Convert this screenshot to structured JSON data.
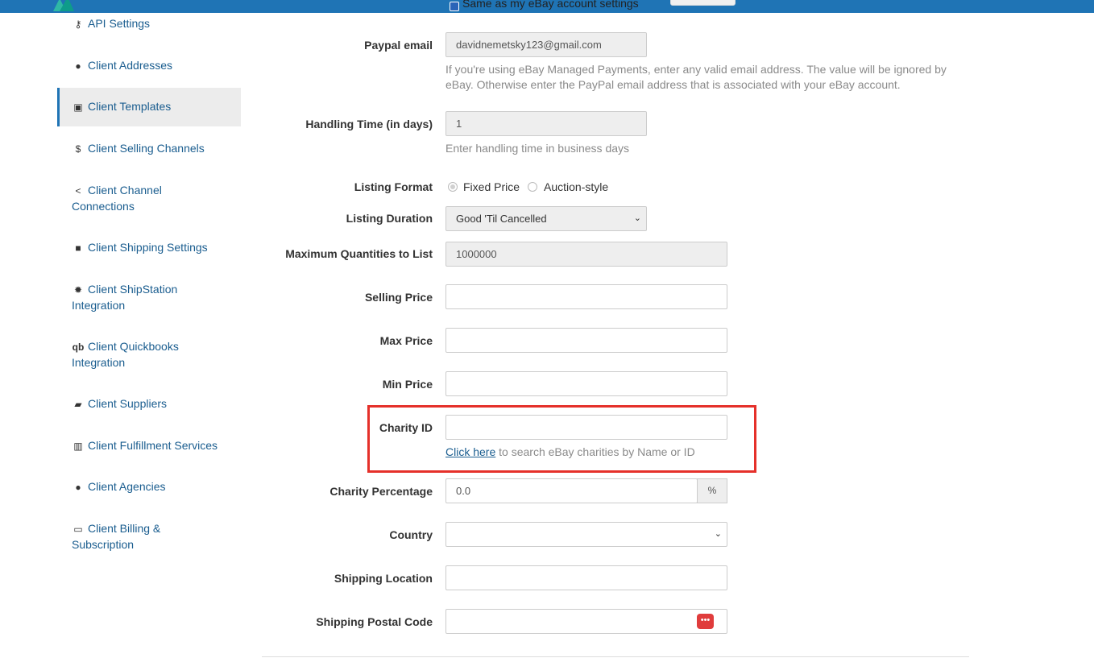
{
  "header": {
    "same_as_checkbox_label": "Same as my eBay account settings"
  },
  "sidebar": {
    "items": [
      {
        "label": "API Settings",
        "icon": "key-icon"
      },
      {
        "label": "Client Addresses",
        "icon": "map-marker-icon"
      },
      {
        "label": "Client Templates",
        "icon": "image-icon",
        "active": true
      },
      {
        "label": "Client Selling Channels",
        "icon": "dollar-icon"
      },
      {
        "label": "Client Channel Connections",
        "icon": "share-icon"
      },
      {
        "label": "Client Shipping Settings",
        "icon": "box-icon"
      },
      {
        "label": "Client ShipStation Integration",
        "icon": "gear-icon"
      },
      {
        "label": "Client Quickbooks Integration",
        "icon": "quickbooks-icon"
      },
      {
        "label": "Client Suppliers",
        "icon": "truck-icon"
      },
      {
        "label": "Client Fulfillment Services",
        "icon": "building-icon"
      },
      {
        "label": "Client Agencies",
        "icon": "map-marker-icon"
      },
      {
        "label": "Client Billing & Subscription",
        "icon": "credit-card-icon"
      }
    ]
  },
  "form": {
    "paypal_email": {
      "label": "Paypal email",
      "value": "davidnemetsky123@gmail.com",
      "help": "If you're using eBay Managed Payments, enter any valid email address. The value will be ignored by eBay. Otherwise enter the PayPal email address that is associated with your eBay account."
    },
    "handling_time": {
      "label": "Handling Time (in days)",
      "value": "1",
      "help": "Enter handling time in business days"
    },
    "listing_format": {
      "label": "Listing Format",
      "options": [
        "Fixed Price",
        "Auction-style"
      ],
      "selected": "Fixed Price"
    },
    "listing_duration": {
      "label": "Listing Duration",
      "value": "Good 'Til Cancelled"
    },
    "max_quantities": {
      "label": "Maximum Quantities to List",
      "value": "1000000"
    },
    "selling_price": {
      "label": "Selling Price",
      "value": ""
    },
    "max_price": {
      "label": "Max Price",
      "value": ""
    },
    "min_price": {
      "label": "Min Price",
      "value": ""
    },
    "charity_id": {
      "label": "Charity ID",
      "value": "",
      "link_text": "Click here",
      "help_rest": " to search eBay charities by Name or ID"
    },
    "charity_percentage": {
      "label": "Charity Percentage",
      "value": "0.0",
      "addon": "%"
    },
    "country": {
      "label": "Country",
      "value": ""
    },
    "shipping_location": {
      "label": "Shipping Location",
      "value": ""
    },
    "shipping_postal_code": {
      "label": "Shipping Postal Code",
      "value": "",
      "icon_glyph": "•••"
    }
  },
  "colors": {
    "topbar": "#1f74b5",
    "link": "#1a5d8f",
    "highlight_border": "#e5302a"
  }
}
